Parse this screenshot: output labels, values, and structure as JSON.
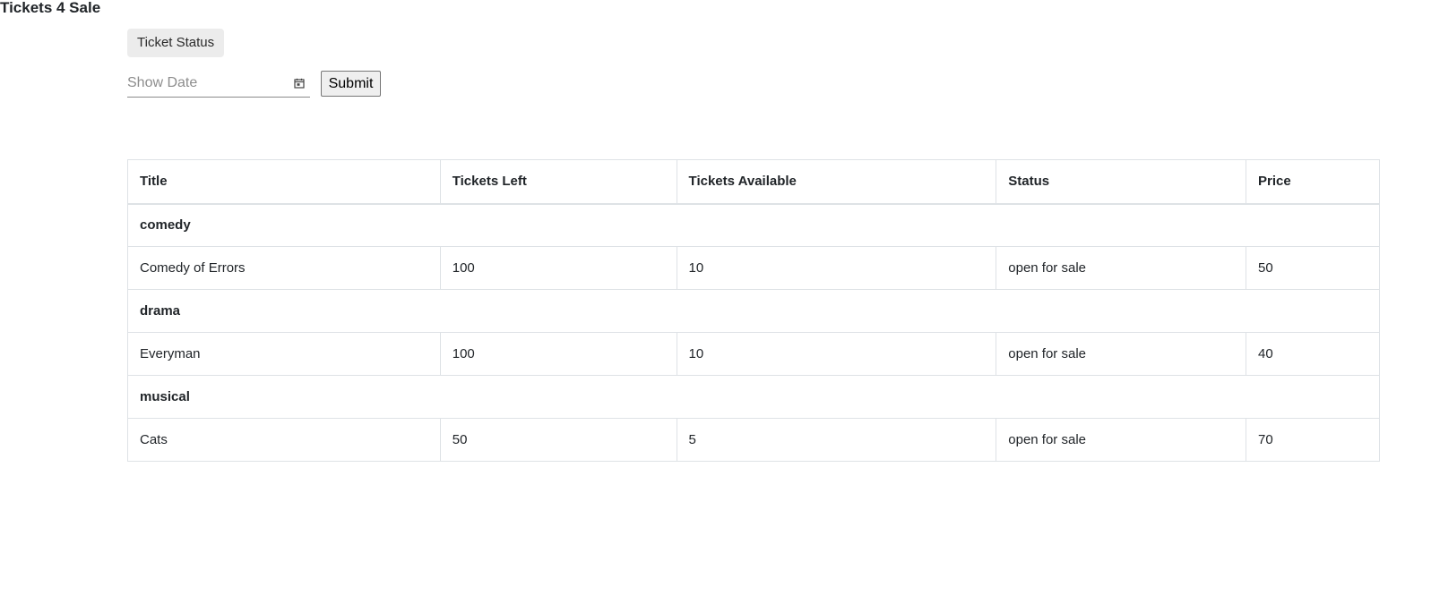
{
  "header": {
    "title": "Tickets 4 Sale"
  },
  "controls": {
    "status_chip_label": "Ticket Status",
    "date_placeholder": "Show Date",
    "date_value": "",
    "submit_label": "Submit"
  },
  "icons": {
    "calendar": "calendar-icon"
  },
  "table": {
    "columns": [
      "Title",
      "Tickets Left",
      "Tickets Available",
      "Status",
      "Price"
    ],
    "groups": [
      {
        "name": "comedy",
        "rows": [
          [
            "Comedy of Errors",
            "100",
            "10",
            "open for sale",
            "50"
          ]
        ]
      },
      {
        "name": "drama",
        "rows": [
          [
            "Everyman",
            "100",
            "10",
            "open for sale",
            "40"
          ]
        ]
      },
      {
        "name": "musical",
        "rows": [
          [
            "Cats",
            "50",
            "5",
            "open for sale",
            "70"
          ]
        ]
      }
    ]
  }
}
